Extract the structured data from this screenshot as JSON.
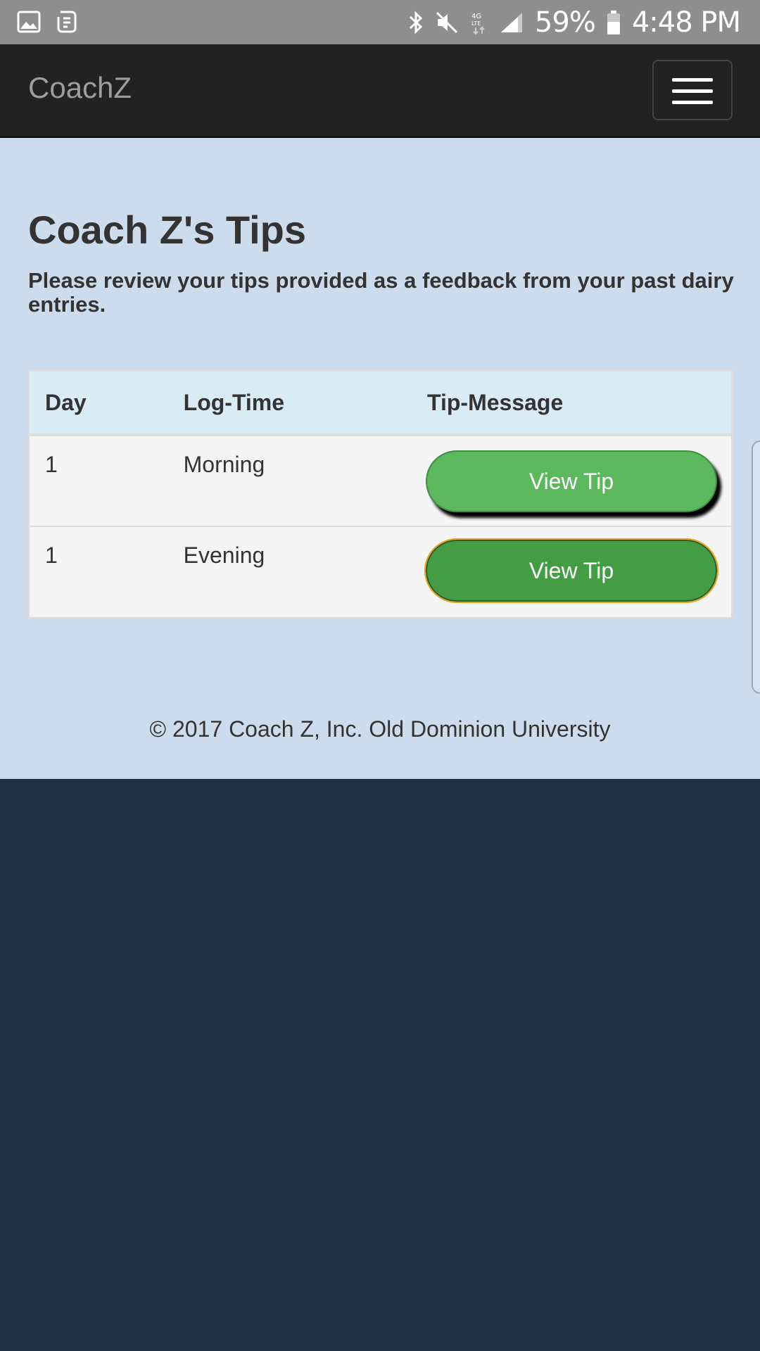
{
  "status_bar": {
    "icons": [
      "image-icon",
      "app-icon",
      "bluetooth-icon",
      "mute-icon",
      "4g-lte-icon",
      "signal-icon",
      "battery-icon"
    ],
    "battery": "59%",
    "time": "4:48 PM"
  },
  "navbar": {
    "brand": "CoachZ"
  },
  "main": {
    "title": "Coach Z's Tips",
    "subtitle": "Please review your tips provided as a feedback from your past dairy entries."
  },
  "table": {
    "headers": [
      "Day",
      "Log-Time",
      "Tip-Message"
    ],
    "rows": [
      {
        "day": "1",
        "log_time": "Morning",
        "button": "View Tip"
      },
      {
        "day": "1",
        "log_time": "Evening",
        "button": "View Tip"
      }
    ]
  },
  "footer": {
    "text": "© 2017 Coach Z, Inc. Old Dominion University"
  },
  "colors": {
    "navbar": "#222222",
    "content_bg": "#ccdcec",
    "page_bg": "#223142",
    "button_green": "#5cb85c",
    "button_green_active": "#449d44",
    "focus_outline": "#e8a317"
  }
}
